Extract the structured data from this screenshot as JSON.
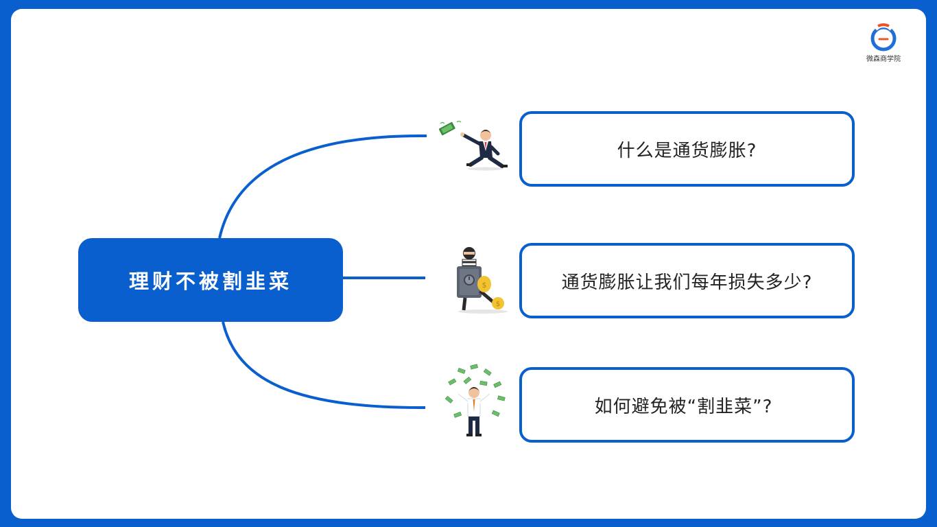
{
  "brand": {
    "name": "微森商学院"
  },
  "mindmap": {
    "root": "理财不被割韭菜",
    "children": [
      {
        "label": "什么是通货膨胀?",
        "illustration": "man-chasing-money-icon"
      },
      {
        "label": "通货膨胀让我们每年损失多少?",
        "illustration": "thief-with-safe-icon"
      },
      {
        "label": "如何避免被“割韭菜”?",
        "illustration": "man-throwing-money-icon"
      }
    ]
  },
  "colors": {
    "accent": "#0a5fce",
    "background": "#ffffff",
    "text": "#222222"
  }
}
